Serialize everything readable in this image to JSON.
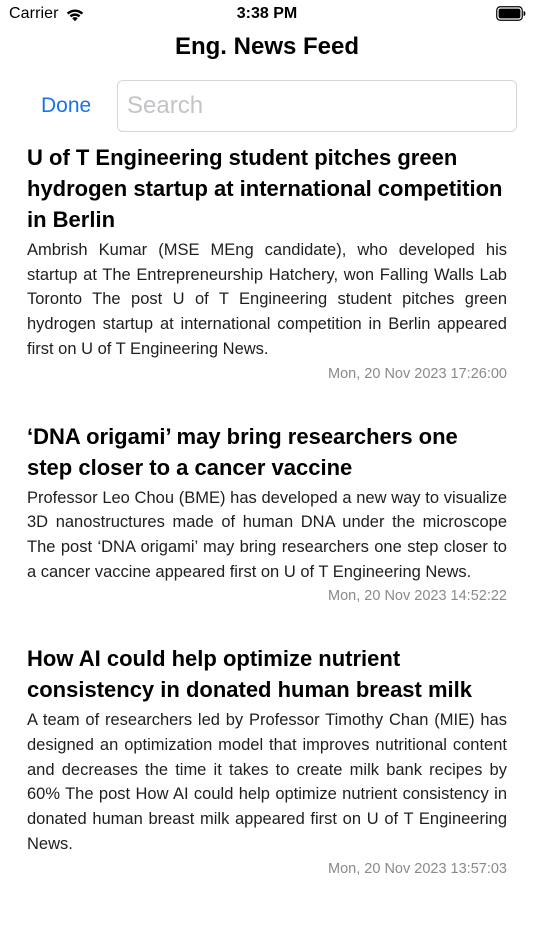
{
  "status_bar": {
    "carrier": "Carrier",
    "time": "3:38 PM"
  },
  "nav": {
    "title": "Eng. News Feed"
  },
  "search": {
    "done_label": "Done",
    "placeholder": "Search",
    "value": ""
  },
  "colors": {
    "accent": "#1a73e8",
    "date_text": "#8a8a8e"
  },
  "articles": [
    {
      "title": "U of T Engineering student pitches green hydrogen startup at international competition in Berlin",
      "summary": "Ambrish Kumar (MSE MEng candidate), who developed his startup at The Entrepreneurship Hatchery, won Falling Walls Lab Toronto The post U of T Engineering student pitches green hydrogen startup at international competition in Berlin appeared first on U of T Engineering News.",
      "date": "Mon, 20 Nov 2023 17:26:00"
    },
    {
      "title": "‘DNA origami’ may bring researchers one step closer to a cancer vaccine",
      "summary": "Professor Leo Chou (BME) has developed a new way to visualize 3D nanostructures made of human DNA under the microscope The post ‘DNA origami’ may bring researchers one step closer to a cancer vaccine appeared first on U of T Engineering News.",
      "date": "Mon, 20 Nov 2023 14:52:22"
    },
    {
      "title": "How AI could help optimize nutrient consistency in donated human breast milk",
      "summary": "A team of researchers led by Professor Timothy Chan (MIE) has designed an optimization model that improves nutritional content and decreases the time it takes to create milk bank recipes by 60% The post How AI could help optimize nutrient consistency in donated human breast milk appeared first on U of T Engineering News.",
      "date": "Mon, 20 Nov 2023 13:57:03"
    }
  ]
}
